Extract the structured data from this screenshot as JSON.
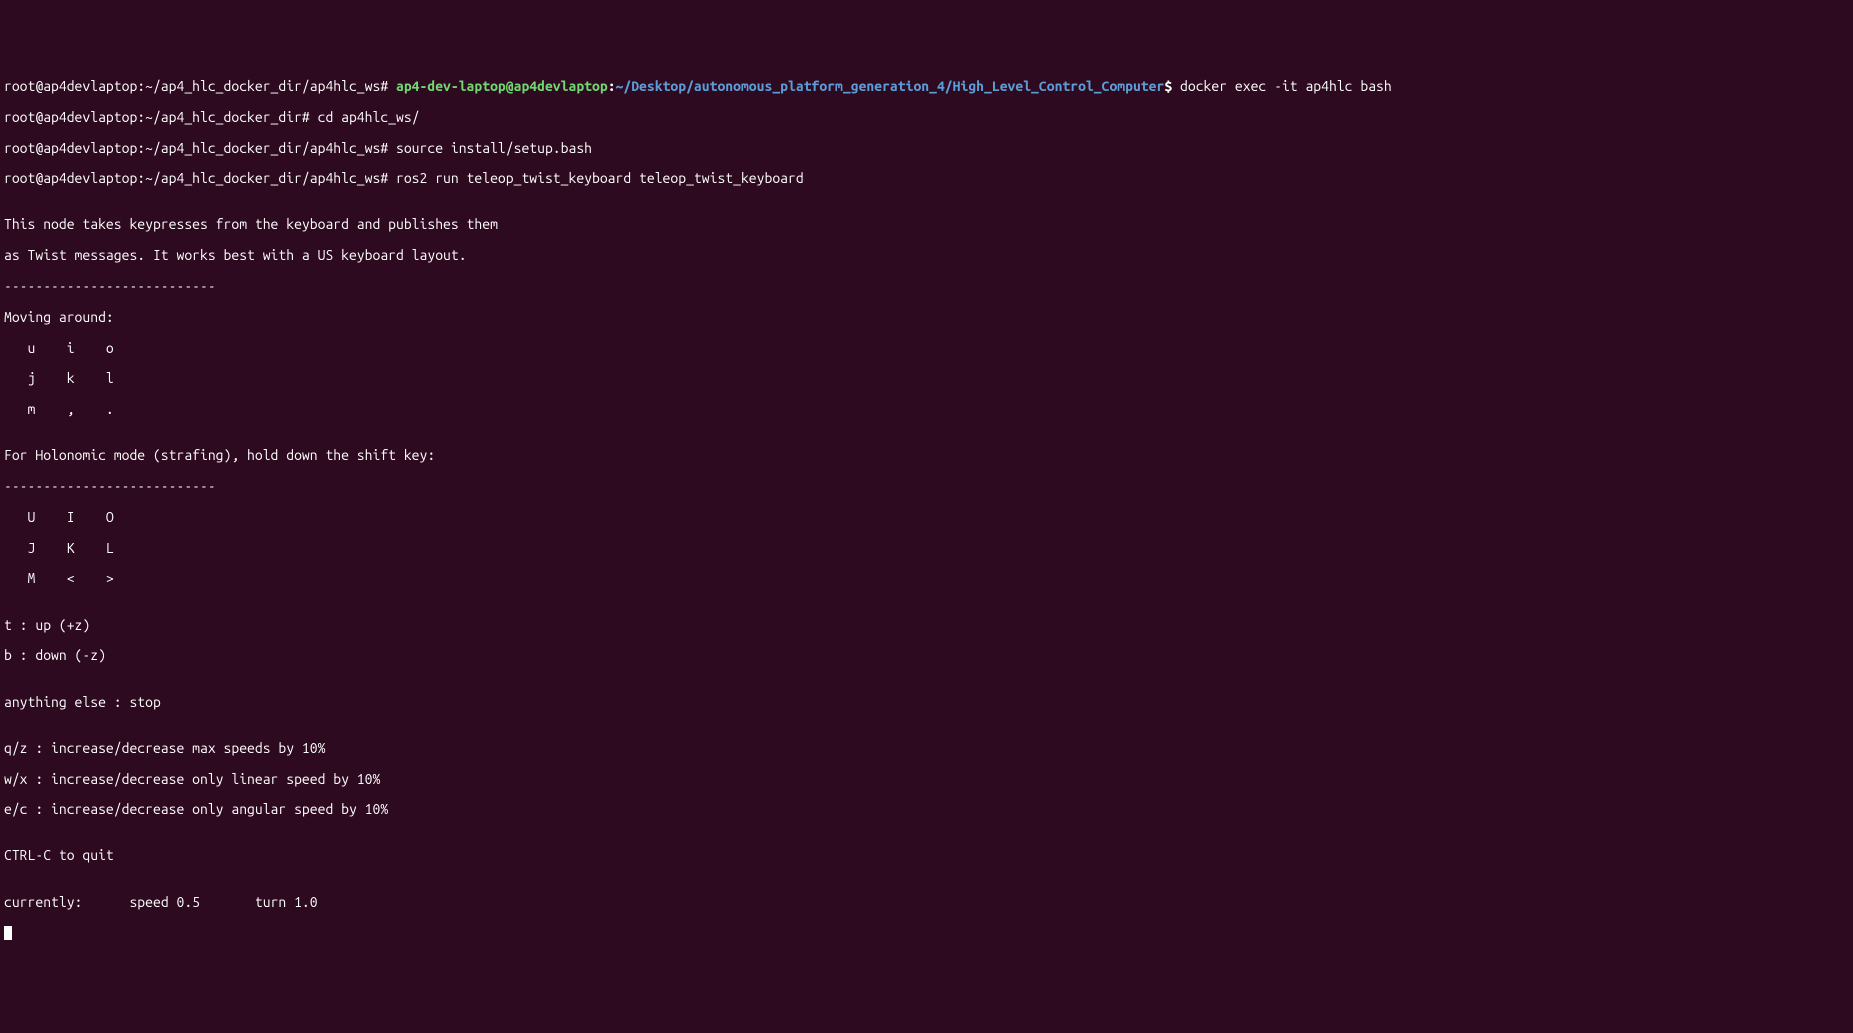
{
  "lines": {
    "line1": {
      "root_prompt": "root@ap4devlaptop:~/ap4_hlc_docker_dir/ap4hlc_ws# ",
      "user": "ap4-dev-laptop@ap4devlaptop",
      "colon": ":",
      "path": "~/Desktop/autonomous_platform_generation_4/High_Level_Control_Computer",
      "dollar": "$ ",
      "cmd": "docker exec -it ap4hlc bash"
    },
    "line2": {
      "prompt": "root@ap4devlaptop:~/ap4_hlc_docker_dir# ",
      "cmd": "cd ap4hlc_ws/"
    },
    "line3": {
      "prompt": "root@ap4devlaptop:~/ap4_hlc_docker_dir/ap4hlc_ws# ",
      "cmd": "source install/setup.bash"
    },
    "line4": {
      "prompt": "root@ap4devlaptop:~/ap4_hlc_docker_dir/ap4hlc_ws# ",
      "cmd": "ros2 run teleop_twist_keyboard teleop_twist_keyboard"
    },
    "blank1": "",
    "out1": "This node takes keypresses from the keyboard and publishes them",
    "out2": "as Twist messages. It works best with a US keyboard layout.",
    "out3": "---------------------------",
    "out4": "Moving around:",
    "out5": "   u    i    o",
    "out6": "   j    k    l",
    "out7": "   m    ,    .",
    "blank2": "",
    "out8": "For Holonomic mode (strafing), hold down the shift key:",
    "out9": "---------------------------",
    "out10": "   U    I    O",
    "out11": "   J    K    L",
    "out12": "   M    <    >",
    "blank3": "",
    "out13": "t : up (+z)",
    "out14": "b : down (-z)",
    "blank4": "",
    "out15": "anything else : stop",
    "blank5": "",
    "out16": "q/z : increase/decrease max speeds by 10%",
    "out17": "w/x : increase/decrease only linear speed by 10%",
    "out18": "e/c : increase/decrease only angular speed by 10%",
    "blank6": "",
    "out19": "CTRL-C to quit",
    "blank7": "",
    "out20": "currently:\tspeed 0.5\tturn 1.0 "
  }
}
